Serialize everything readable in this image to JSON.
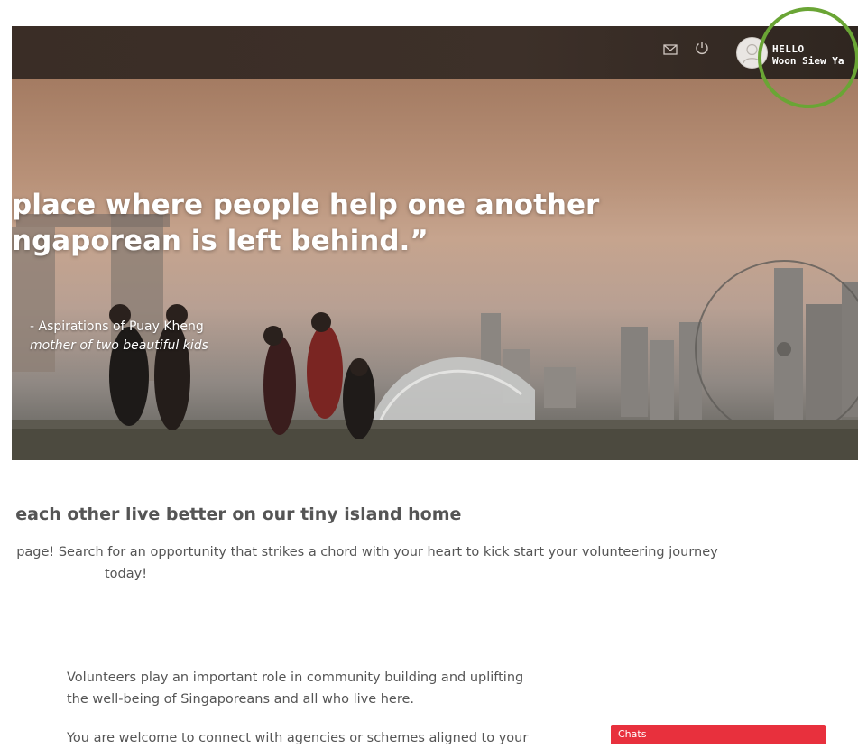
{
  "header": {
    "greeting": "HELLO",
    "username": "Woon Siew Ya",
    "icons": {
      "mail": "mail-icon",
      "power": "power-icon",
      "avatar": "user-avatar-icon"
    }
  },
  "hero": {
    "quote_line1": "place where people help one another",
    "quote_line2": "ngaporean is left behind.”",
    "attribution_name": "- Aspirations of Puay Kheng",
    "attribution_detail": "mother of two beautiful kids"
  },
  "content": {
    "tagline": ") each other live better on our tiny island home",
    "intro_line1": "is page! Search for an opportunity that strikes a chord with your heart to kick start your volunteering journey",
    "intro_line2": "today!",
    "paragraph1_line1": "Volunteers play an important role in community building and uplifting",
    "paragraph1_line2": "the well-being of Singaporeans and all who live here.",
    "paragraph2_line1": "You are welcome to connect with agencies or schemes aligned to your"
  },
  "chat": {
    "label": "Chats"
  },
  "colors": {
    "header_bg": "#3a2d26",
    "chat_bar": "#e8303d",
    "highlight_circle": "#6aa535",
    "text": "#555555"
  }
}
